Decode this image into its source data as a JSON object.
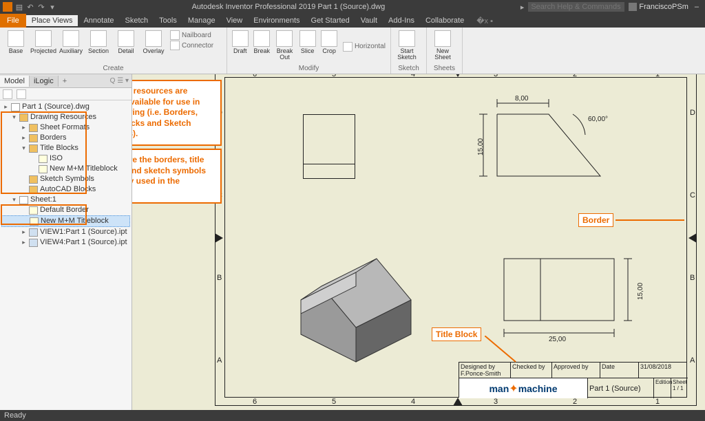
{
  "app": {
    "title": "Autodesk Inventor Professional 2019  Part 1 (Source).dwg",
    "search_placeholder": "Search Help & Commands",
    "user": "FranciscoPSm",
    "status": "Ready"
  },
  "menubar": {
    "file": "File",
    "tabs": [
      "Place Views",
      "Annotate",
      "Sketch",
      "Tools",
      "Manage",
      "View",
      "Environments",
      "Get Started",
      "Vault",
      "Add-Ins",
      "Collaborate"
    ]
  },
  "ribbon": {
    "groups": [
      {
        "label": "Create",
        "buttons": [
          "Base",
          "Projected",
          "Auxiliary",
          "Section",
          "Detail",
          "Overlay"
        ],
        "stack": [
          "Nailboard",
          "Connector"
        ]
      },
      {
        "label": "Modify",
        "buttons": [
          "Draft",
          "Break",
          "Break Out",
          "Slice",
          "Crop"
        ],
        "side": [
          "Horizontal",
          "Start Sketch"
        ]
      },
      {
        "label": "Sketch",
        "buttons": [
          "Start Sketch"
        ]
      },
      {
        "label": "Sheets",
        "buttons": [
          "New Sheet"
        ]
      }
    ]
  },
  "browser": {
    "tabs": {
      "model": "Model",
      "ilogic": "iLogic"
    },
    "q": "Q ☰ ▾",
    "root": "Part 1 (Source).dwg",
    "drawing_resources": "Drawing Resources",
    "sheet_formats": "Sheet Formats",
    "borders": "Borders",
    "title_blocks": "Title Blocks",
    "iso": "ISO",
    "new_tb": "New M+M Titleblock",
    "sketch_symbols": "Sketch Symbols",
    "autocad_blocks": "AutoCAD Blocks",
    "sheet1": "Sheet:1",
    "default_border": "Default Border",
    "new_tb2": "New M+M Titleblock",
    "view1": "VIEW1:Part 1 (Source).ipt",
    "view4": "VIEW4:Part 1 (Source).ipt"
  },
  "callouts": {
    "resources": "Drawing resources are things available for use in the drawing (i.e. Borders, Title Blocks and Sketch Symbols).",
    "sheet": "These are the borders, title blocks and sketch symbols currently used in the drawing.",
    "border_label": "Border",
    "titleblock_label": "Title Block"
  },
  "dims": {
    "top_width": "8,00",
    "top_height": "15,00",
    "top_angle": "60,00°",
    "side_width": "25,00",
    "side_height": "15,00"
  },
  "ruler": [
    "6",
    "5",
    "4",
    "3",
    "2",
    "1"
  ],
  "side_ruler_left": [
    "D",
    "C",
    "B",
    "A"
  ],
  "titleblock": {
    "designed_by_label": "Designed by",
    "designed_by": "F.Ponce-Smith",
    "checked_by_label": "Checked by",
    "approved_by_label": "Approved by",
    "date_label": "Date",
    "date": "31/08/2018",
    "logo1": "man",
    "logo2": "machine",
    "part": "Part 1 (Source)",
    "edition_label": "Edition",
    "sheet_label": "Sheet",
    "sheet": "1 / 1"
  }
}
